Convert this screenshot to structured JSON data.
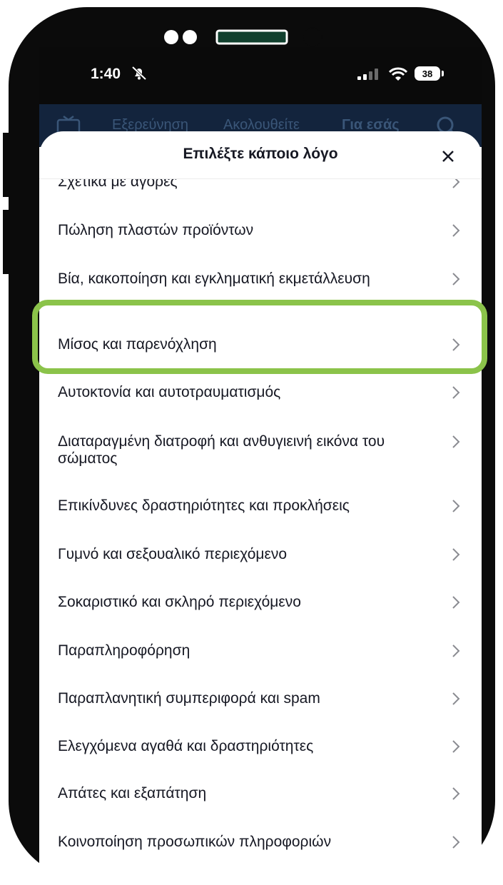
{
  "status_bar": {
    "time": "1:40",
    "battery": "38"
  },
  "app_nav": {
    "tabs": [
      {
        "label": "Εξερεύνηση"
      },
      {
        "label": "Ακολουθείτε"
      },
      {
        "label": "Για εσάς"
      }
    ]
  },
  "sheet": {
    "title": "Επιλέξτε κάποιο λόγο",
    "reasons": [
      "Σχετικά με αγορές",
      "Πώληση πλαστών προϊόντων",
      "Βία, κακοποίηση και εγκληματική εκμετάλλευση",
      "Μίσος και παρενόχληση",
      "Αυτοκτονία και αυτοτραυματισμός",
      "Διαταραγμένη διατροφή και ανθυγιεινή εικόνα του σώματος",
      "Επικίνδυνες δραστηριότητες και προκλήσεις",
      "Γυμνό και σεξουαλικό περιεχόμενο",
      "Σοκαριστικό και σκληρό περιεχόμενο",
      "Παραπληροφόρηση",
      "Παραπλανητική συμπεριφορά και spam",
      "Ελεγχόμενα αγαθά και δραστηριότητες",
      "Απάτες και εξαπάτηση",
      "Κοινοποίηση προσωπικών πληροφοριών"
    ]
  },
  "colors": {
    "highlight": "#8bc34a",
    "nav_background": "#13243d",
    "text": "#161823"
  }
}
